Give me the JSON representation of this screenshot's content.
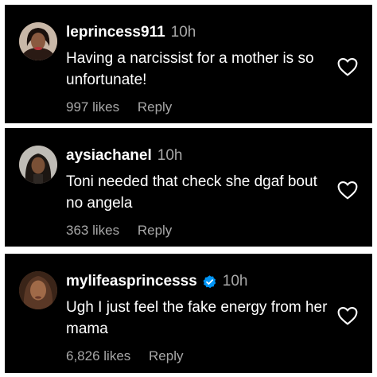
{
  "comments": [
    {
      "username": "leprincess911",
      "time": "10h",
      "text": "Having a narcissist for a mother is so unfortunate!",
      "likes": "997 likes",
      "reply_label": "Reply",
      "verified": false
    },
    {
      "username": "aysiachanel",
      "time": "10h",
      "text": "Toni needed that check she dgaf bout no angela",
      "likes": "363 likes",
      "reply_label": "Reply",
      "verified": false
    },
    {
      "username": "mylifeasprincesss",
      "time": "10h",
      "text": "Ugh I just feel the fake energy from her mama",
      "likes": "6,826 likes",
      "reply_label": "Reply",
      "verified": true
    }
  ],
  "icons": {
    "like": "heart-outline-icon",
    "verified": "verified-badge-icon"
  },
  "colors": {
    "card_bg": "#000000",
    "page_bg": "#ffffff",
    "primary_text": "#ffffff",
    "secondary_text": "#a8a8a8",
    "verified_blue": "#0095f6"
  }
}
